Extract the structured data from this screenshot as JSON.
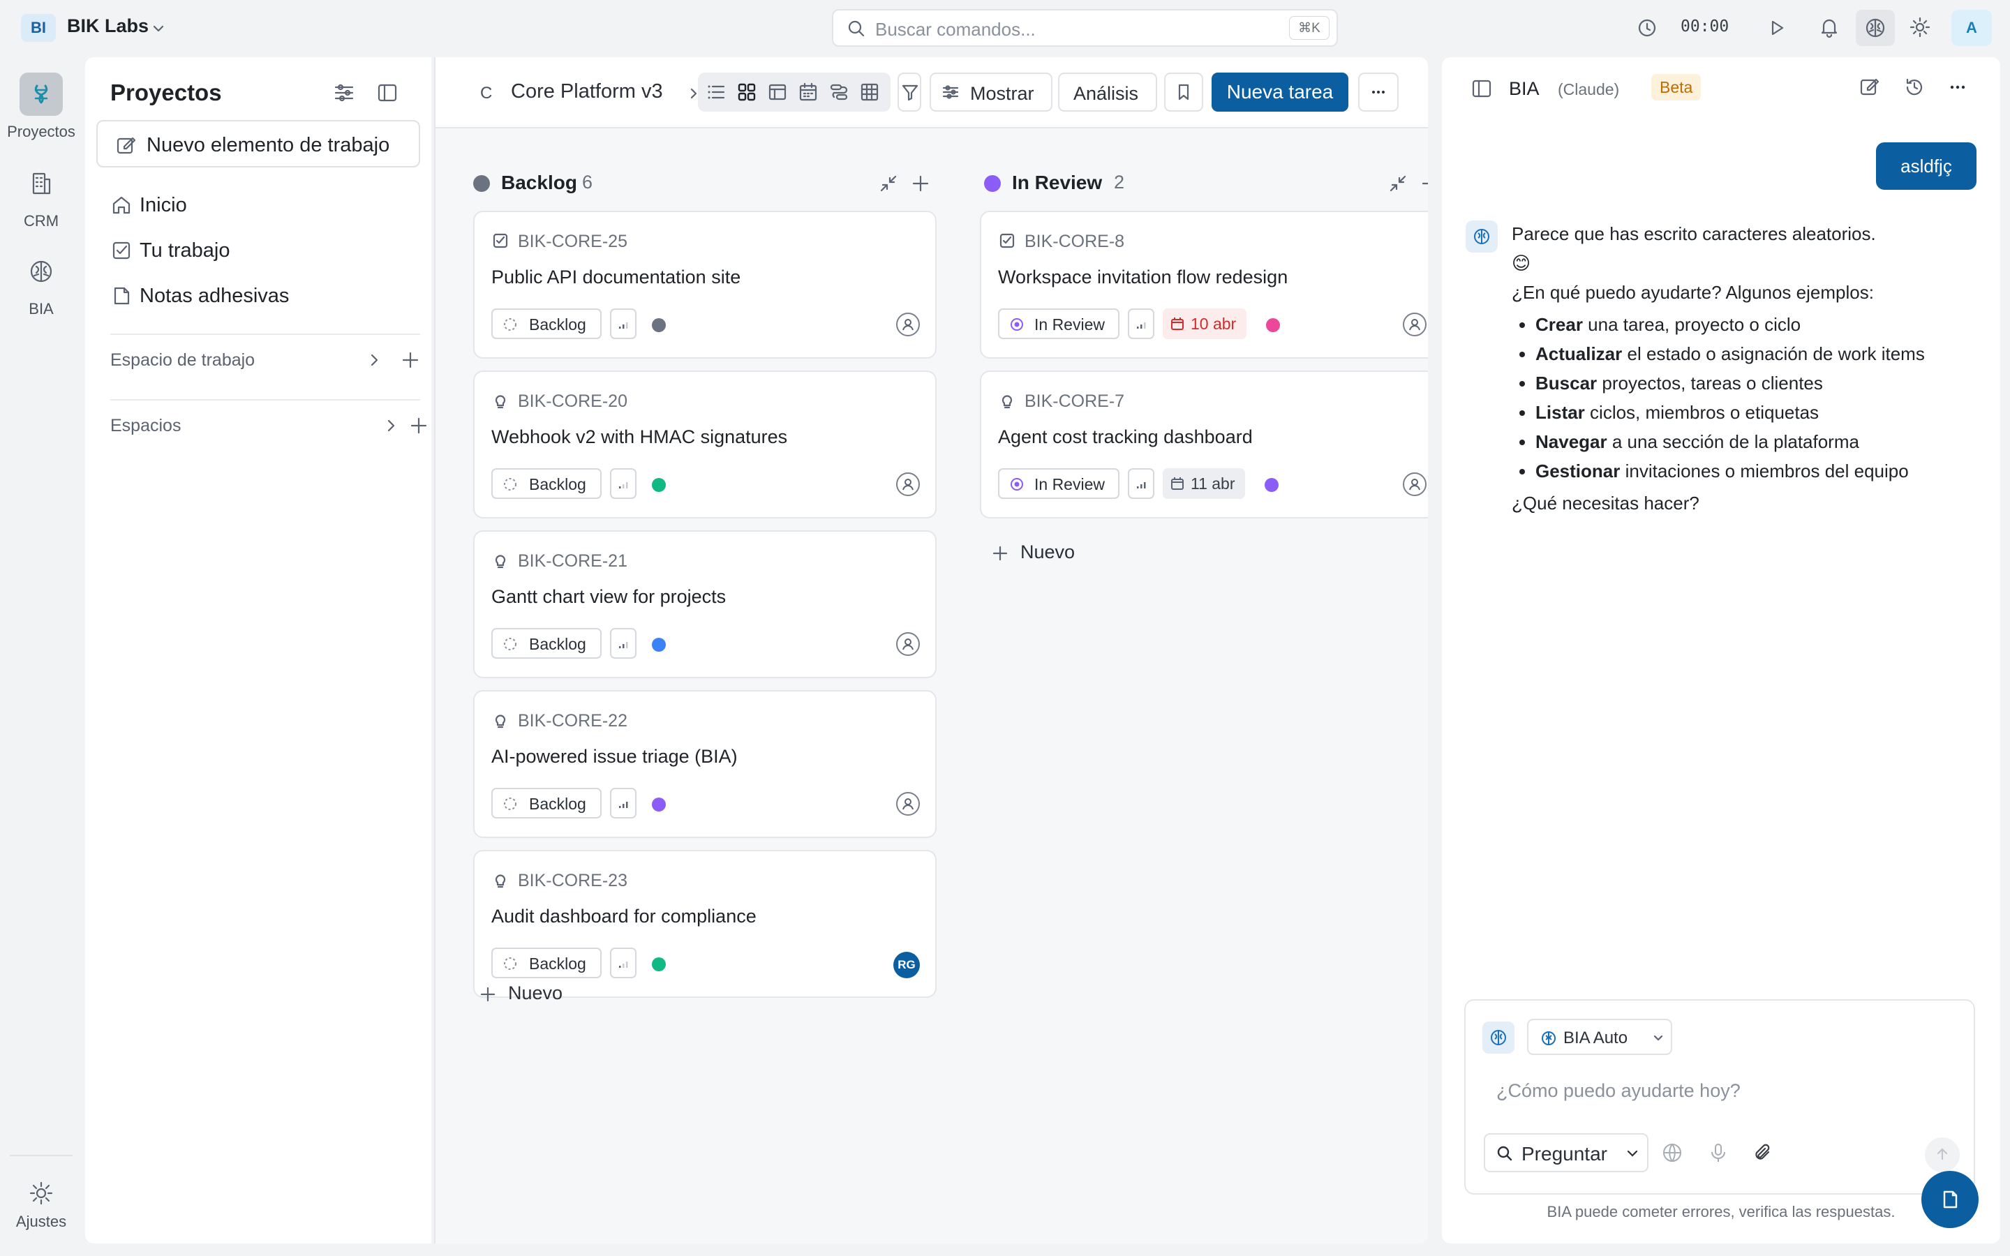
{
  "workspace": {
    "initials": "BI",
    "name": "BIK Labs"
  },
  "search": {
    "placeholder": "Buscar comandos...",
    "shortcut": "⌘K"
  },
  "timer": "00:00",
  "user": {
    "initial": "A"
  },
  "rail": {
    "items": [
      {
        "label": "Proyectos",
        "icon": "projects-icon"
      },
      {
        "label": "CRM",
        "icon": "building-icon"
      },
      {
        "label": "BIA",
        "icon": "brain-icon"
      }
    ],
    "bottom": {
      "label": "Ajustes",
      "icon": "gear-icon"
    }
  },
  "sidebar": {
    "title": "Proyectos",
    "new_item": "Nuevo elemento de trabajo",
    "nav": [
      {
        "label": "Inicio",
        "icon": "home-icon"
      },
      {
        "label": "Tu trabajo",
        "icon": "checkbox-icon"
      },
      {
        "label": "Notas adhesivas",
        "icon": "note-icon"
      }
    ],
    "sections": [
      {
        "label": "Espacio de trabajo"
      },
      {
        "label": "Espacios"
      }
    ]
  },
  "board": {
    "project_initial": "C",
    "project_name": "Core Platform v3",
    "mostrar": "Mostrar",
    "analisis": "Análisis",
    "new_task": "Nueva tarea",
    "new_label": "Nuevo",
    "columns": [
      {
        "title": "Backlog",
        "count": "6",
        "color": "#6b7280",
        "cards": [
          {
            "id": "BIK-CORE-25",
            "title": "Public API documentation site",
            "status": "Backlog",
            "icon": "checkbox-icon",
            "dot": "#6b7280",
            "assignee": ""
          },
          {
            "id": "BIK-CORE-20",
            "title": "Webhook v2 with HMAC signatures",
            "status": "Backlog",
            "icon": "lightbulb-icon",
            "dot": "#10b981",
            "assignee": ""
          },
          {
            "id": "BIK-CORE-21",
            "title": "Gantt chart view for projects",
            "status": "Backlog",
            "icon": "lightbulb-icon",
            "dot": "#3b82f6",
            "assignee": ""
          },
          {
            "id": "BIK-CORE-22",
            "title": "AI-powered issue triage (BIA)",
            "status": "Backlog",
            "icon": "lightbulb-icon",
            "dot": "#8b5cf6",
            "assignee": ""
          },
          {
            "id": "BIK-CORE-23",
            "title": "Audit dashboard for compliance",
            "status": "Backlog",
            "icon": "lightbulb-icon",
            "dot": "#10b981",
            "assignee": "RG"
          }
        ]
      },
      {
        "title": "In Review",
        "count": "2",
        "color": "#8b5cf6",
        "cards": [
          {
            "id": "BIK-CORE-8",
            "title": "Workspace invitation flow redesign",
            "status": "In Review",
            "icon": "checkbox-icon",
            "dot": "#ec4899",
            "date": "10 abr",
            "date_overdue": true
          },
          {
            "id": "BIK-CORE-7",
            "title": "Agent cost tracking dashboard",
            "status": "In Review",
            "icon": "lightbulb-icon",
            "dot": "#8b5cf6",
            "date": "11 abr",
            "date_overdue": false
          }
        ]
      }
    ]
  },
  "assistant": {
    "title": "BIA",
    "subtitle": "(Claude)",
    "beta": "Beta",
    "user_message": "asldfjç",
    "reply": {
      "line1": "Parece que has escrito caracteres aleatorios.",
      "emoji": "😊",
      "line2": "¿En qué puedo ayudarte? Algunos ejemplos:",
      "items": [
        {
          "bold": "Crear",
          "rest": " una tarea, proyecto o ciclo"
        },
        {
          "bold": "Actualizar",
          "rest": " el estado o asignación de work items"
        },
        {
          "bold": "Buscar",
          "rest": " proyectos, tareas o clientes"
        },
        {
          "bold": "Listar",
          "rest": " ciclos, miembros o etiquetas"
        },
        {
          "bold": "Navegar",
          "rest": " a una sección de la plataforma"
        },
        {
          "bold": "Gestionar",
          "rest": " invitaciones o miembros del equipo"
        }
      ],
      "closing": "¿Qué necesitas hacer?"
    },
    "model": "BIA Auto",
    "placeholder": "¿Cómo puedo ayudarte hoy?",
    "mode": "Preguntar",
    "disclaimer": "BIA puede cometer errores, verifica las respuestas."
  }
}
